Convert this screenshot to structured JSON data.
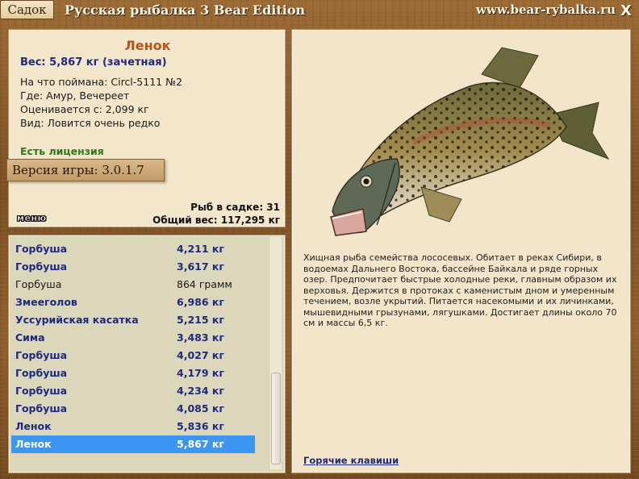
{
  "header": {
    "tab_label": "Садок",
    "title": "Русская рыбалка 3 Bear Edition",
    "site": "www.bear-rybalka.ru",
    "close": "X"
  },
  "fish": {
    "name": "Ленок",
    "weight": "Вес: 5,867 кг (зачетная)",
    "caught_with": "На что поймана: Circl-5111 №2",
    "where": "Где: Амур, Вечереет",
    "valued_from": "Оценивается с: 2,099 кг",
    "rarity": "Вид: Ловится очень редко",
    "license": "Есть лицензия"
  },
  "version": "Версия игры: 3.0.1.7",
  "menu_label": "меню",
  "stats": {
    "fish_count": "Рыб в садке: 31",
    "total_weight": "Общий вес: 117,295 кг"
  },
  "catch_list": [
    {
      "name": "Горбуша",
      "weight": "4,211 кг",
      "style": "bold"
    },
    {
      "name": "Горбуша",
      "weight": "3,617 кг",
      "style": "bold"
    },
    {
      "name": "Горбуша",
      "weight": "864 грамм",
      "style": "plain"
    },
    {
      "name": "Змееголов",
      "weight": "6,986 кг",
      "style": "bold"
    },
    {
      "name": "Уссурийская касатка",
      "weight": "5,215 кг",
      "style": "bold"
    },
    {
      "name": "Сима",
      "weight": "3,483 кг",
      "style": "bold"
    },
    {
      "name": "Горбуша",
      "weight": "4,027 кг",
      "style": "bold"
    },
    {
      "name": "Горбуша",
      "weight": "4,179 кг",
      "style": "bold"
    },
    {
      "name": "Горбуша",
      "weight": "4,234 кг",
      "style": "bold"
    },
    {
      "name": "Горбуша",
      "weight": "4,085 кг",
      "style": "bold"
    },
    {
      "name": "Ленок",
      "weight": "5,836 кг",
      "style": "bold"
    },
    {
      "name": "Ленок",
      "weight": "5,867 кг",
      "style": "selected"
    }
  ],
  "description": "Хищная рыба семейства лососевых. Обитает в реках Сибири, в водоемах Дальнего Востока, бассейне Байкала и ряде горных озер. Предпочитает быстрые холодные реки, главным образом их верховья. Держится в протоках с каменистым дном и умеренным течением,  возле укрытий. Питается насекомыми и их личинками, мышевидными грызунами, лягушками. Достигает длины около 70 см и массы 6,5 кг.",
  "hotkeys_link": "Горячие клавиши",
  "colors": {
    "selected_row": "#3b97f1",
    "fish_name": "#b4541a",
    "list_text": "#1f2a7a",
    "license": "#2c7a1a"
  }
}
